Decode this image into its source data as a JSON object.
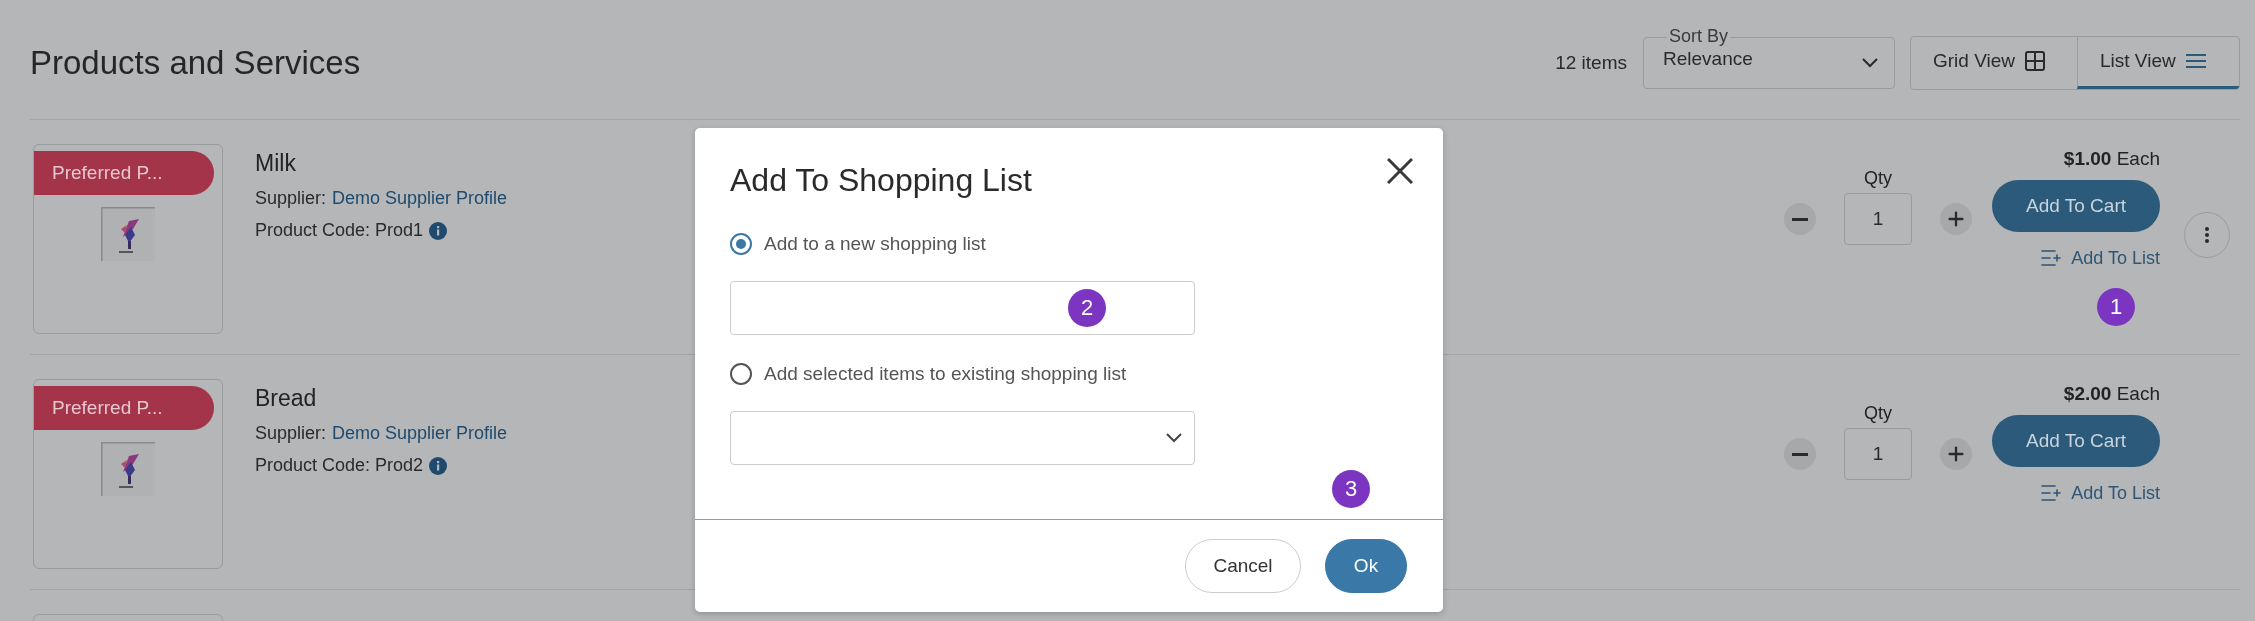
{
  "page": {
    "title": "Products and Services",
    "item_count": "12 items",
    "sort": {
      "label": "Sort By",
      "value": "Relevance"
    },
    "views": [
      {
        "label": "Grid View",
        "kind": "grid",
        "selected": false
      },
      {
        "label": "List View",
        "kind": "list",
        "selected": true
      }
    ]
  },
  "products": [
    {
      "badge": "Preferred P...",
      "name": "Milk",
      "supplier_label": "Supplier:",
      "supplier": "Demo Supplier Profile",
      "code": "Product Code: Prod1",
      "qty_label": "Qty",
      "qty": "1",
      "price": "$1.00",
      "unit": "Each",
      "cart_button": "Add To Cart",
      "list_link": "Add To List",
      "more_menu": true,
      "annotation": "1"
    },
    {
      "badge": "Preferred P...",
      "name": "Bread",
      "supplier_label": "Supplier:",
      "supplier": "Demo Supplier Profile",
      "code": "Product Code: Prod2",
      "qty_label": "Qty",
      "qty": "1",
      "price": "$2.00",
      "unit": "Each",
      "cart_button": "Add To Cart",
      "list_link": "Add To List",
      "more_menu": false
    }
  ],
  "dialog": {
    "title": "Add To Shopping List",
    "options": [
      {
        "label": "Add to a new shopping list",
        "kind": "text",
        "selected": true,
        "annotation": "2"
      },
      {
        "label": "Add selected items to existing shopping list",
        "kind": "select",
        "selected": false
      }
    ],
    "footer_annotation": "3",
    "buttons": [
      {
        "label": "Cancel",
        "kind": "secondary"
      },
      {
        "label": "Ok",
        "kind": "primary"
      }
    ]
  }
}
